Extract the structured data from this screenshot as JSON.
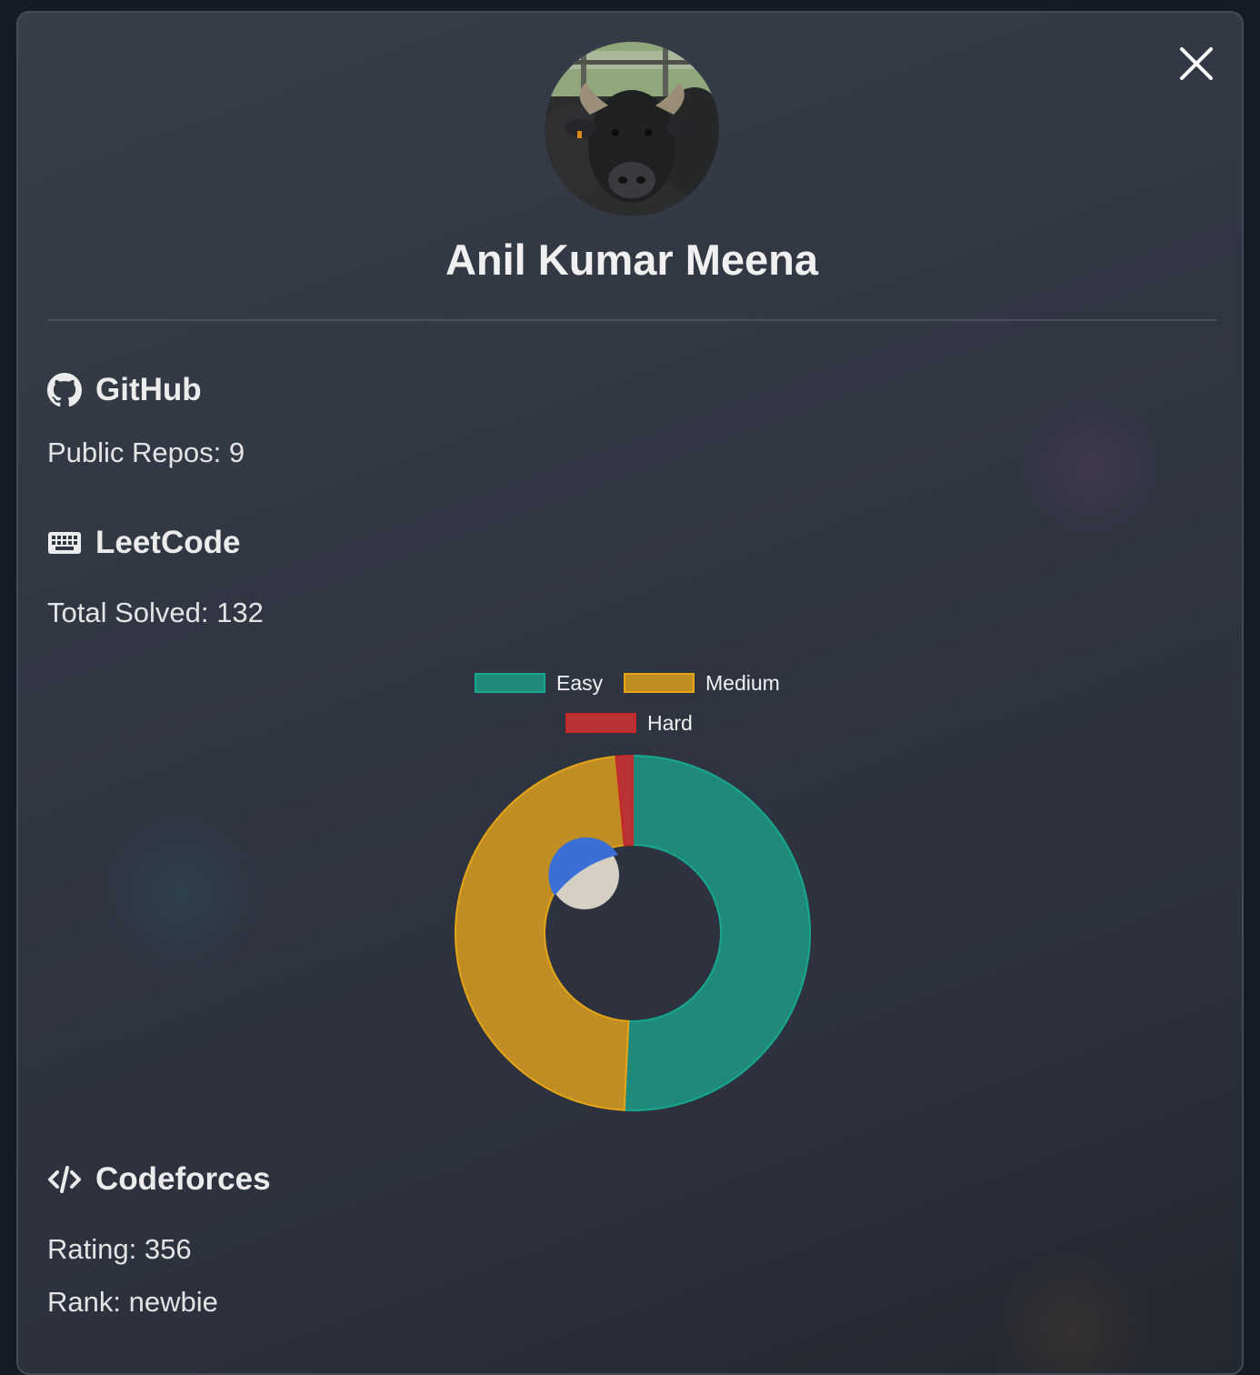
{
  "profile": {
    "name": "Anil Kumar Meena",
    "avatar_icon": "water-buffalo-photo"
  },
  "close_icon": "close-icon",
  "github": {
    "title": "GitHub",
    "icon": "github-icon",
    "public_repos": "Public Repos: 9"
  },
  "leetcode": {
    "title": "LeetCode",
    "icon": "keyboard-icon",
    "total_solved": "Total Solved: 132"
  },
  "codeforces": {
    "title": "Codeforces",
    "icon": "code-icon",
    "rating": "Rating: 356",
    "rank": "Rank: newbie"
  },
  "chart_data": {
    "type": "doughnut",
    "labels": [
      "Easy",
      "Medium",
      "Hard"
    ],
    "values": [
      67,
      63,
      2
    ],
    "colors": [
      "#1f8a7a",
      "#c08d24",
      "#b83236"
    ],
    "border_colors": [
      "#17a88f",
      "#e6a517",
      "#c62828"
    ],
    "legend_position": "top"
  }
}
